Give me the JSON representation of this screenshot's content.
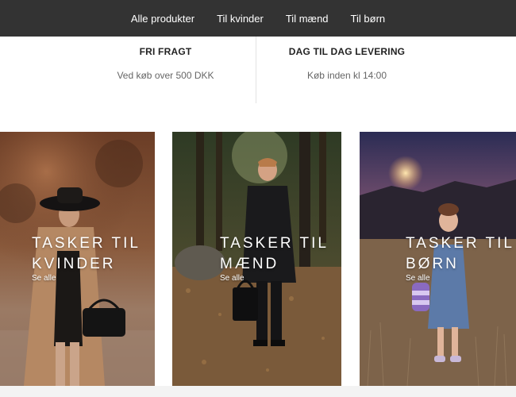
{
  "nav": {
    "items": [
      "Alle produkter",
      "Til kvinder",
      "Til mænd",
      "Til børn"
    ]
  },
  "features": [
    {
      "title": "FRI FRAGT",
      "subtitle": "Ved køb over 500 DKK"
    },
    {
      "title": "DAG TIL DAG LEVERING",
      "subtitle": "Køb inden kl 14:00"
    }
  ],
  "cards": [
    {
      "title_line1": "TASKER TIL",
      "title_line2": "KVINDER",
      "link": "Se alle"
    },
    {
      "title_line1": "TASKER TIL",
      "title_line2": "MÆND",
      "link": "Se alle"
    },
    {
      "title_line1": "TASKER TIL",
      "title_line2": "BØRN",
      "link": "Se alle"
    }
  ],
  "colors": {
    "nav_bg": "#333333",
    "nav_text": "#ffffff"
  }
}
